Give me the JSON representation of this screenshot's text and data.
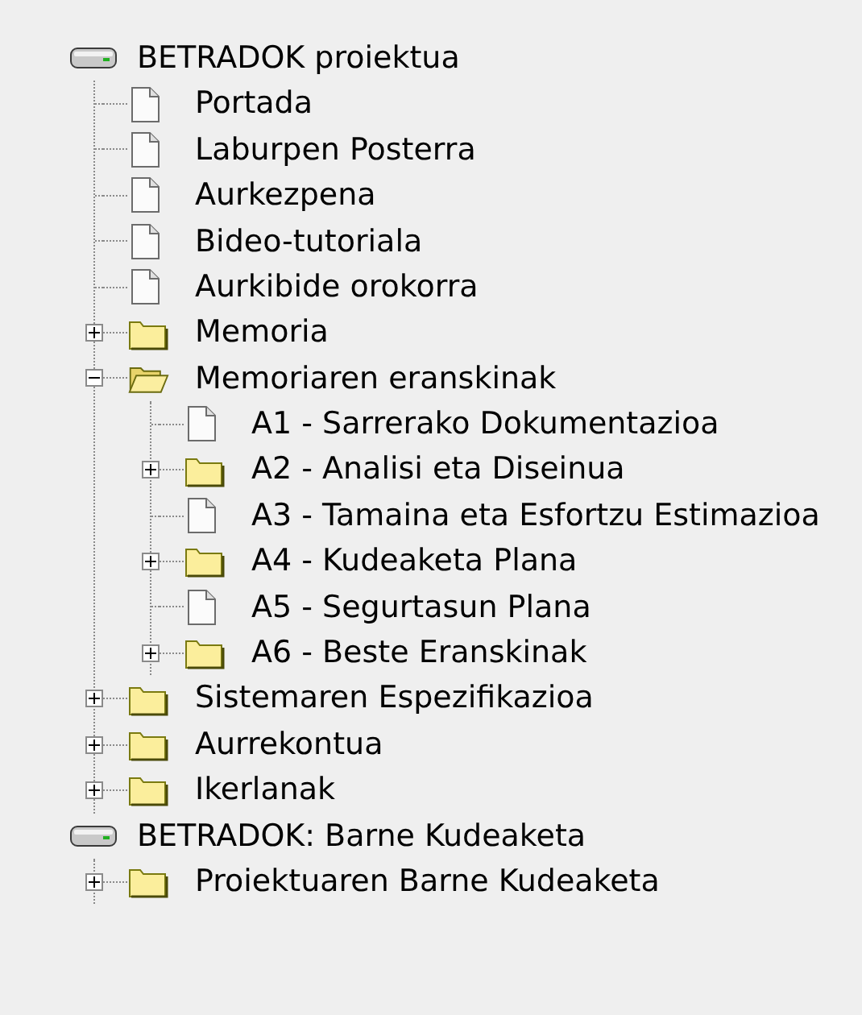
{
  "roots": [
    {
      "label": "BETRADOK proiektua",
      "children": [
        {
          "kind": "document",
          "label": "Portada"
        },
        {
          "kind": "document",
          "label": "Laburpen Posterra"
        },
        {
          "kind": "document",
          "label": "Aurkezpena"
        },
        {
          "kind": "document",
          "label": "Bideo-tutoriala"
        },
        {
          "kind": "document",
          "label": "Aurkibide orokorra"
        },
        {
          "kind": "folder",
          "label": "Memoria",
          "expanded": false
        },
        {
          "kind": "folder",
          "label": "Memoriaren eranskinak",
          "expanded": true,
          "children": [
            {
              "kind": "document",
              "label": "A1 - Sarrerako Dokumentazioa"
            },
            {
              "kind": "folder",
              "label": "A2 - Analisi eta Diseinua",
              "expanded": false
            },
            {
              "kind": "document",
              "label": "A3 - Tamaina eta Esfortzu Estimazioa"
            },
            {
              "kind": "folder",
              "label": "A4 - Kudeaketa Plana",
              "expanded": false
            },
            {
              "kind": "document",
              "label": "A5 - Segurtasun Plana"
            },
            {
              "kind": "folder",
              "label": "A6 - Beste Eranskinak",
              "expanded": false
            }
          ]
        },
        {
          "kind": "folder",
          "label": "Sistemaren Espezifikazioa",
          "expanded": false
        },
        {
          "kind": "folder",
          "label": "Aurrekontua",
          "expanded": false
        },
        {
          "kind": "folder",
          "label": "Ikerlanak",
          "expanded": false
        }
      ]
    },
    {
      "label": "BETRADOK: Barne Kudeaketa",
      "children": [
        {
          "kind": "folder",
          "label": "Proiektuaren Barne Kudeaketa",
          "expanded": false
        }
      ]
    }
  ]
}
